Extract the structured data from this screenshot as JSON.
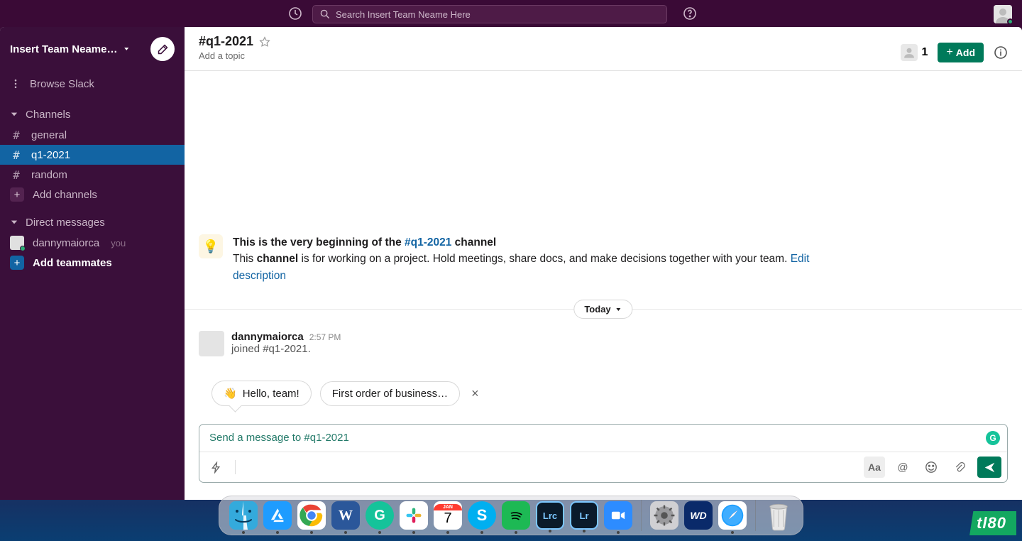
{
  "topbar": {
    "search_placeholder": "Search Insert Team Neame Here"
  },
  "sidebar": {
    "workspace_name": "Insert Team Neame He...",
    "browse_label": "Browse Slack",
    "channels_label": "Channels",
    "channels": [
      {
        "name": "general",
        "active": false
      },
      {
        "name": "q1-2021",
        "active": true
      },
      {
        "name": "random",
        "active": false
      }
    ],
    "add_channels_label": "Add channels",
    "dm_label": "Direct messages",
    "dms": [
      {
        "name": "dannymaiorca",
        "you_label": "you"
      }
    ],
    "add_teammates_label": "Add teammates"
  },
  "channel": {
    "title": "#q1-2021",
    "topic_placeholder": "Add a topic",
    "member_count": "1",
    "add_button": "Add"
  },
  "welcome": {
    "prefix": "This is the very beginning of the ",
    "channel_link": "#q1-2021",
    "suffix": " channel",
    "line2_a": "This ",
    "line2_b": "channel",
    "line2_c": " is for working on a project. Hold meetings, share docs, and make decisions together with your team. ",
    "edit_link": "Edit description"
  },
  "divider_date": "Today",
  "message": {
    "user": "dannymaiorca",
    "time": "2:57 PM",
    "body": "joined #q1-2021."
  },
  "suggestions": {
    "chip1_emoji": "👋",
    "chip1_text": "Hello, team!",
    "chip2_text": "First order of business…"
  },
  "composer": {
    "placeholder": "Send a message to #q1-2021",
    "aa": "Aa",
    "at": "@"
  },
  "dock": {
    "apps": [
      {
        "name": "finder",
        "bg": "#3fa7f5",
        "label": ":)",
        "running": true
      },
      {
        "name": "appstore",
        "bg": "#1e9cff",
        "label": "A",
        "running": true
      },
      {
        "name": "chrome",
        "bg": "#fff",
        "label": "",
        "running": true
      },
      {
        "name": "word",
        "bg": "#2b579a",
        "label": "W",
        "running": true
      },
      {
        "name": "grammarly",
        "bg": "#15c39a",
        "label": "G",
        "running": true
      },
      {
        "name": "slack",
        "bg": "#fff",
        "label": "",
        "running": true
      },
      {
        "name": "calendar",
        "bg": "#fff",
        "label": "7",
        "running": true
      },
      {
        "name": "skype",
        "bg": "#00aff0",
        "label": "S",
        "running": true
      },
      {
        "name": "spotify",
        "bg": "#1db954",
        "label": "",
        "running": true
      },
      {
        "name": "lrc",
        "bg": "#0a1a2a",
        "label": "Lrc",
        "running": true
      },
      {
        "name": "lightroom",
        "bg": "#0a1a2a",
        "label": "Lr",
        "running": true
      },
      {
        "name": "zoom",
        "bg": "#2d8cff",
        "label": "",
        "running": true
      }
    ],
    "apps2": [
      {
        "name": "settings",
        "bg": "#d0d0d3",
        "label": "⚙",
        "running": false
      },
      {
        "name": "wd",
        "bg": "#0a2a6a",
        "label": "WD",
        "running": false
      },
      {
        "name": "safari",
        "bg": "#fff",
        "label": "",
        "running": true
      }
    ],
    "apps3": [
      {
        "name": "trash",
        "bg": "#e8e8e8",
        "label": "",
        "running": false
      }
    ]
  },
  "watermark": "tl80"
}
